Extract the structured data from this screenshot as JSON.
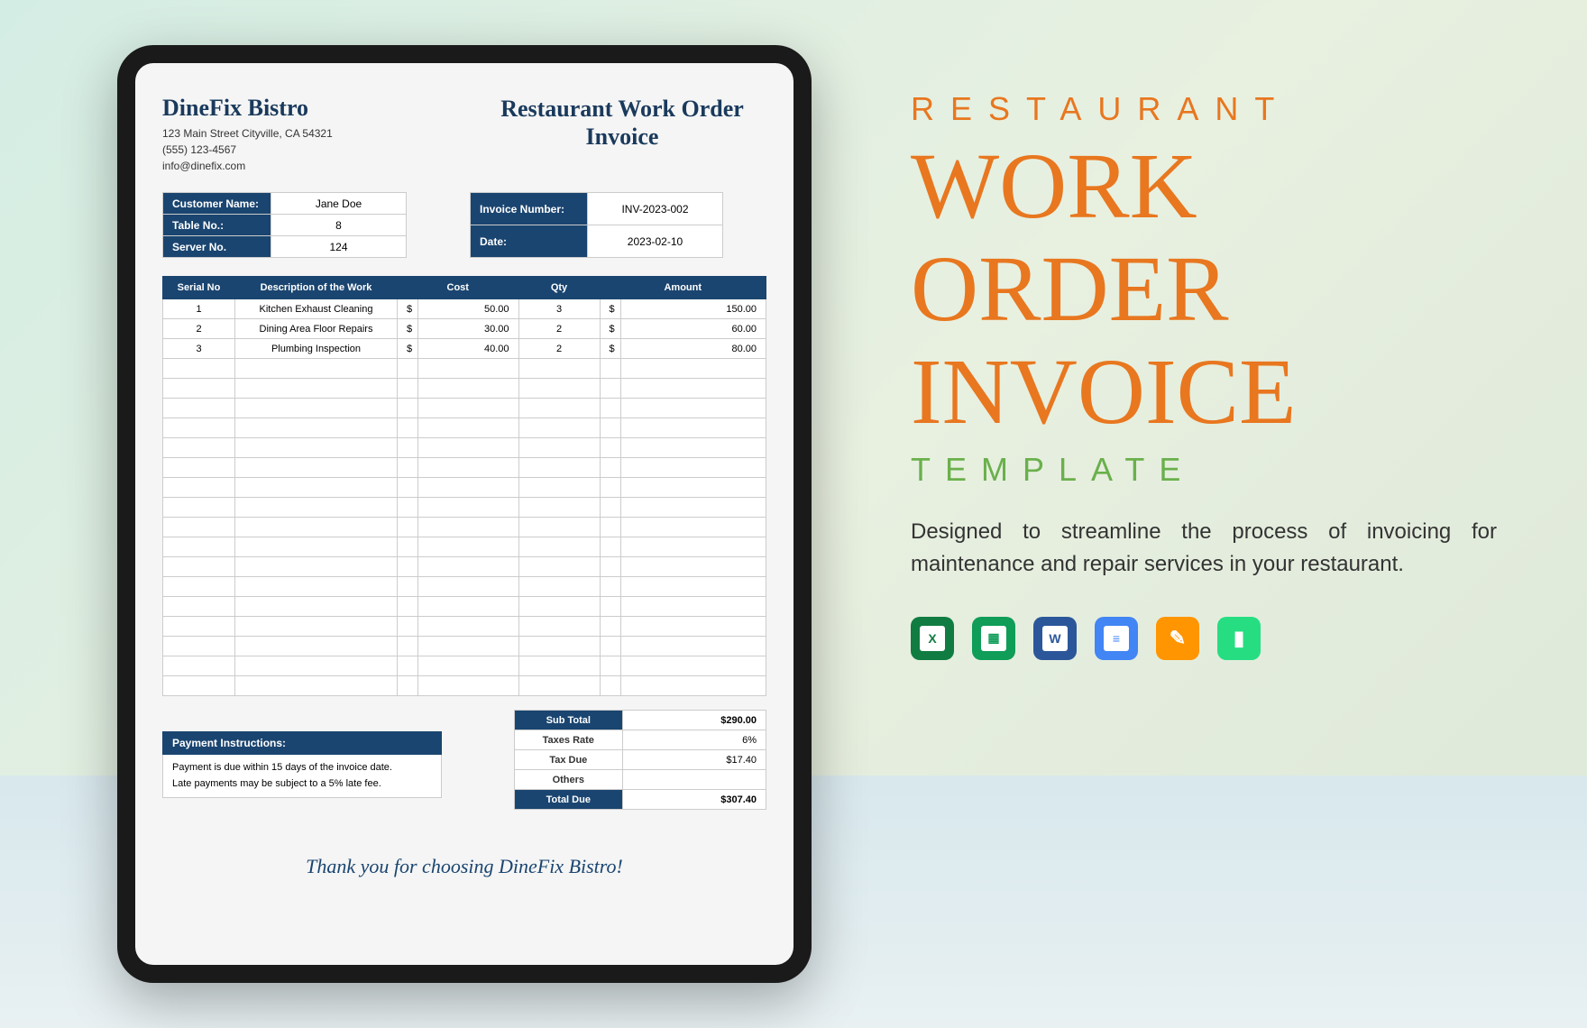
{
  "company": {
    "name": "DineFix Bistro",
    "address": "123 Main Street Cityville, CA 54321",
    "phone": "(555) 123-4567",
    "email": "info@dinefix.com"
  },
  "docTitle": "Restaurant Work Order Invoice",
  "customerInfo": {
    "customerNameLabel": "Customer Name:",
    "customerName": "Jane Doe",
    "tableNoLabel": "Table No.:",
    "tableNo": "8",
    "serverNoLabel": "Server No.",
    "serverNo": "124"
  },
  "invoiceInfo": {
    "invoiceNumberLabel": "Invoice Number:",
    "invoiceNumber": "INV-2023-002",
    "dateLabel": "Date:",
    "date": "2023-02-10"
  },
  "columns": {
    "serial": "Serial No",
    "desc": "Description of the Work",
    "cost": "Cost",
    "qty": "Qty",
    "amount": "Amount"
  },
  "items": [
    {
      "serial": "1",
      "desc": "Kitchen Exhaust Cleaning",
      "cost": "50.00",
      "qty": "3",
      "amount": "150.00"
    },
    {
      "serial": "2",
      "desc": "Dining Area Floor Repairs",
      "cost": "30.00",
      "qty": "2",
      "amount": "60.00"
    },
    {
      "serial": "3",
      "desc": "Plumbing Inspection",
      "cost": "40.00",
      "qty": "2",
      "amount": "80.00"
    }
  ],
  "payment": {
    "header": "Payment Instructions:",
    "line1": "Payment is due within 15 days of the invoice date.",
    "line2": "Late payments may be subject to a 5% late fee."
  },
  "totals": {
    "subTotalLabel": "Sub Total",
    "subTotal": "$290.00",
    "taxRateLabel": "Taxes Rate",
    "taxRate": "6%",
    "taxDueLabel": "Tax Due",
    "taxDue": "$17.40",
    "othersLabel": "Others",
    "others": "",
    "totalDueLabel": "Total Due",
    "totalDue": "$307.40"
  },
  "thanks": "Thank you for choosing DineFix Bistro!",
  "promo": {
    "restaurant": "RESTAURANT",
    "line1": "WORK",
    "line2": "ORDER",
    "line3": "INVOICE",
    "template": "TEMPLATE",
    "description": "Designed to streamline the process of invoicing for maintenance and repair services in your restaurant."
  },
  "icons": {
    "excel": "X",
    "sheets": "▦",
    "word": "W",
    "docs": "≡",
    "pages": "✎",
    "numbers": "▮"
  },
  "currency": "$"
}
